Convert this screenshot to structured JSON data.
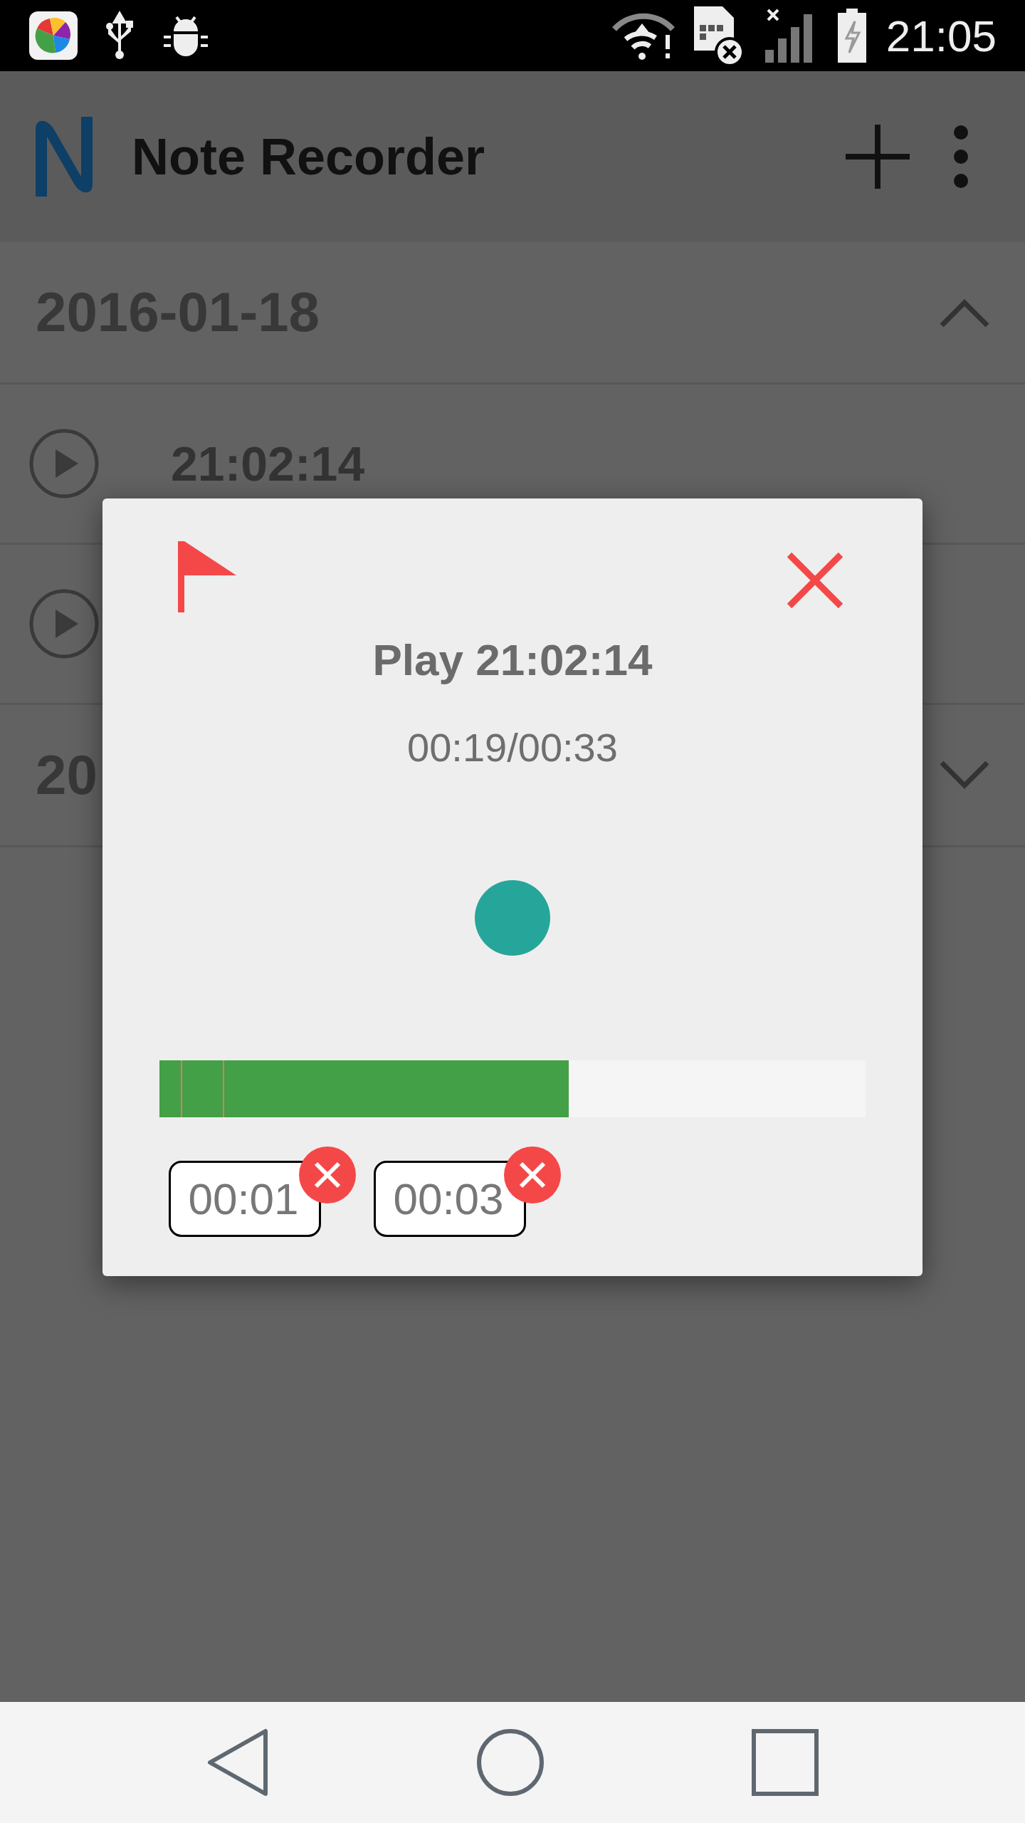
{
  "status_bar": {
    "time": "21:05"
  },
  "app_bar": {
    "title": "Note Recorder"
  },
  "groups": [
    {
      "date": "2016-01-18",
      "expanded": true,
      "recordings": [
        {
          "kind": "recording",
          "title": "21:02:14"
        },
        {
          "kind": "recording"
        }
      ]
    },
    {
      "date": "20",
      "expanded": false
    }
  ],
  "dialog": {
    "title": "Play 21:02:14",
    "time": "00:19/00:33",
    "progress": {
      "level": 0.58
    },
    "marks": [
      {
        "level": 0.03
      },
      {
        "level": 0.09
      }
    ],
    "mark_chips": [
      {
        "label": "00:01"
      },
      {
        "label": "00:03"
      }
    ]
  }
}
